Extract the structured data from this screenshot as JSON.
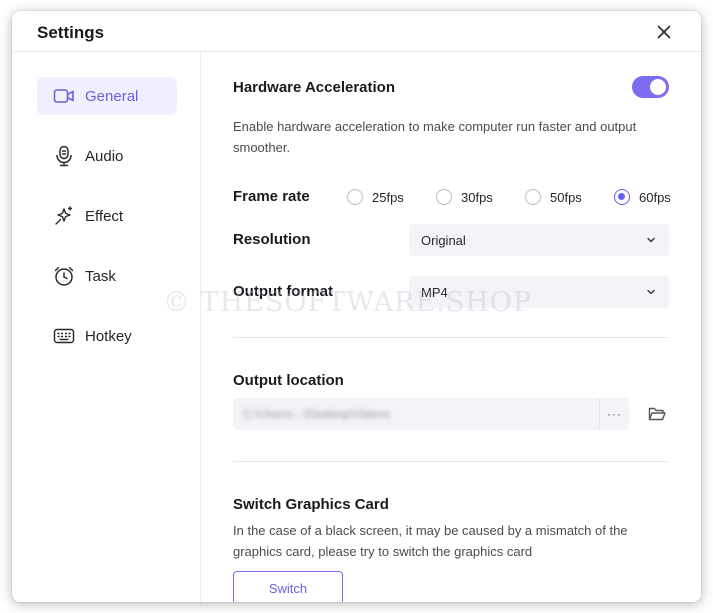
{
  "dialog": {
    "title": "Settings"
  },
  "sidebar": {
    "items": [
      {
        "label": "General",
        "icon": "camera-icon",
        "active": true
      },
      {
        "label": "Audio",
        "icon": "microphone-icon",
        "active": false
      },
      {
        "label": "Effect",
        "icon": "sparkle-icon",
        "active": false
      },
      {
        "label": "Task",
        "icon": "alarm-clock-icon",
        "active": false
      },
      {
        "label": "Hotkey",
        "icon": "keyboard-icon",
        "active": false
      }
    ]
  },
  "general": {
    "hardware_acceleration": {
      "label": "Hardware Acceleration",
      "description": "Enable hardware acceleration to make computer run faster and output smoother.",
      "enabled": true
    },
    "frame_rate": {
      "label": "Frame rate",
      "options": [
        "25fps",
        "30fps",
        "50fps",
        "60fps"
      ],
      "selected": "60fps"
    },
    "resolution": {
      "label": "Resolution",
      "value": "Original"
    },
    "output_format": {
      "label": "Output format",
      "value": "MP4"
    },
    "output_location": {
      "label": "Output location",
      "path": "C:\\Users\\...\\Desktop\\Videos",
      "more": "···"
    },
    "graphics_card": {
      "label": "Switch Graphics Card",
      "description": "In the case of a black screen, it may be caused by a mismatch of the graphics card, please try to switch the graphics card",
      "button": "Switch"
    }
  },
  "watermark": "© THESOFTWARE.SHOP",
  "colors": {
    "accent": "#7b6cf0",
    "active_bg": "#f0f0fd",
    "field_bg": "#f3f3f8"
  }
}
